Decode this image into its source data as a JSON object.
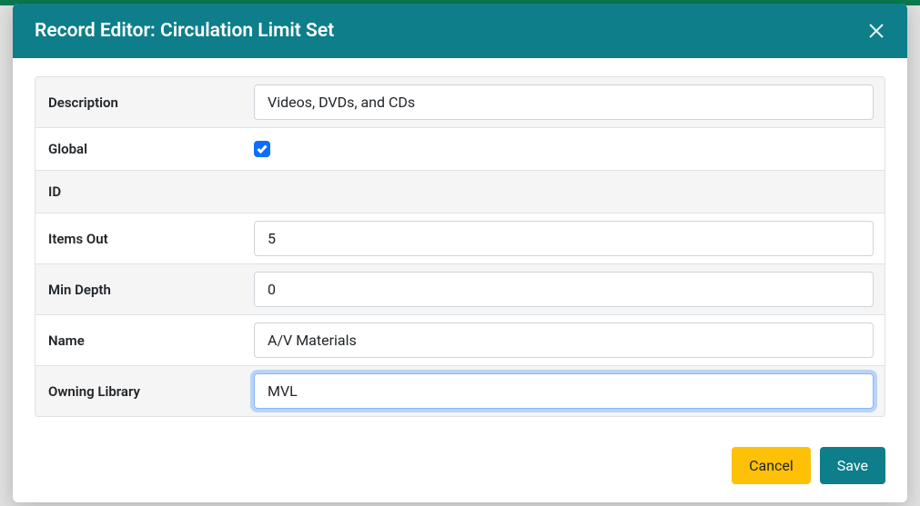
{
  "modal": {
    "title": "Record Editor: Circulation Limit Set"
  },
  "form": {
    "labels": {
      "description": "Description",
      "global": "Global",
      "id": "ID",
      "items_out": "Items Out",
      "min_depth": "Min Depth",
      "name": "Name",
      "owning_library": "Owning Library"
    },
    "values": {
      "description": "Videos, DVDs, and CDs",
      "global": true,
      "id": "",
      "items_out": "5",
      "min_depth": "0",
      "name": "A/V Materials",
      "owning_library": "MVL"
    }
  },
  "footer": {
    "cancel": "Cancel",
    "save": "Save"
  }
}
